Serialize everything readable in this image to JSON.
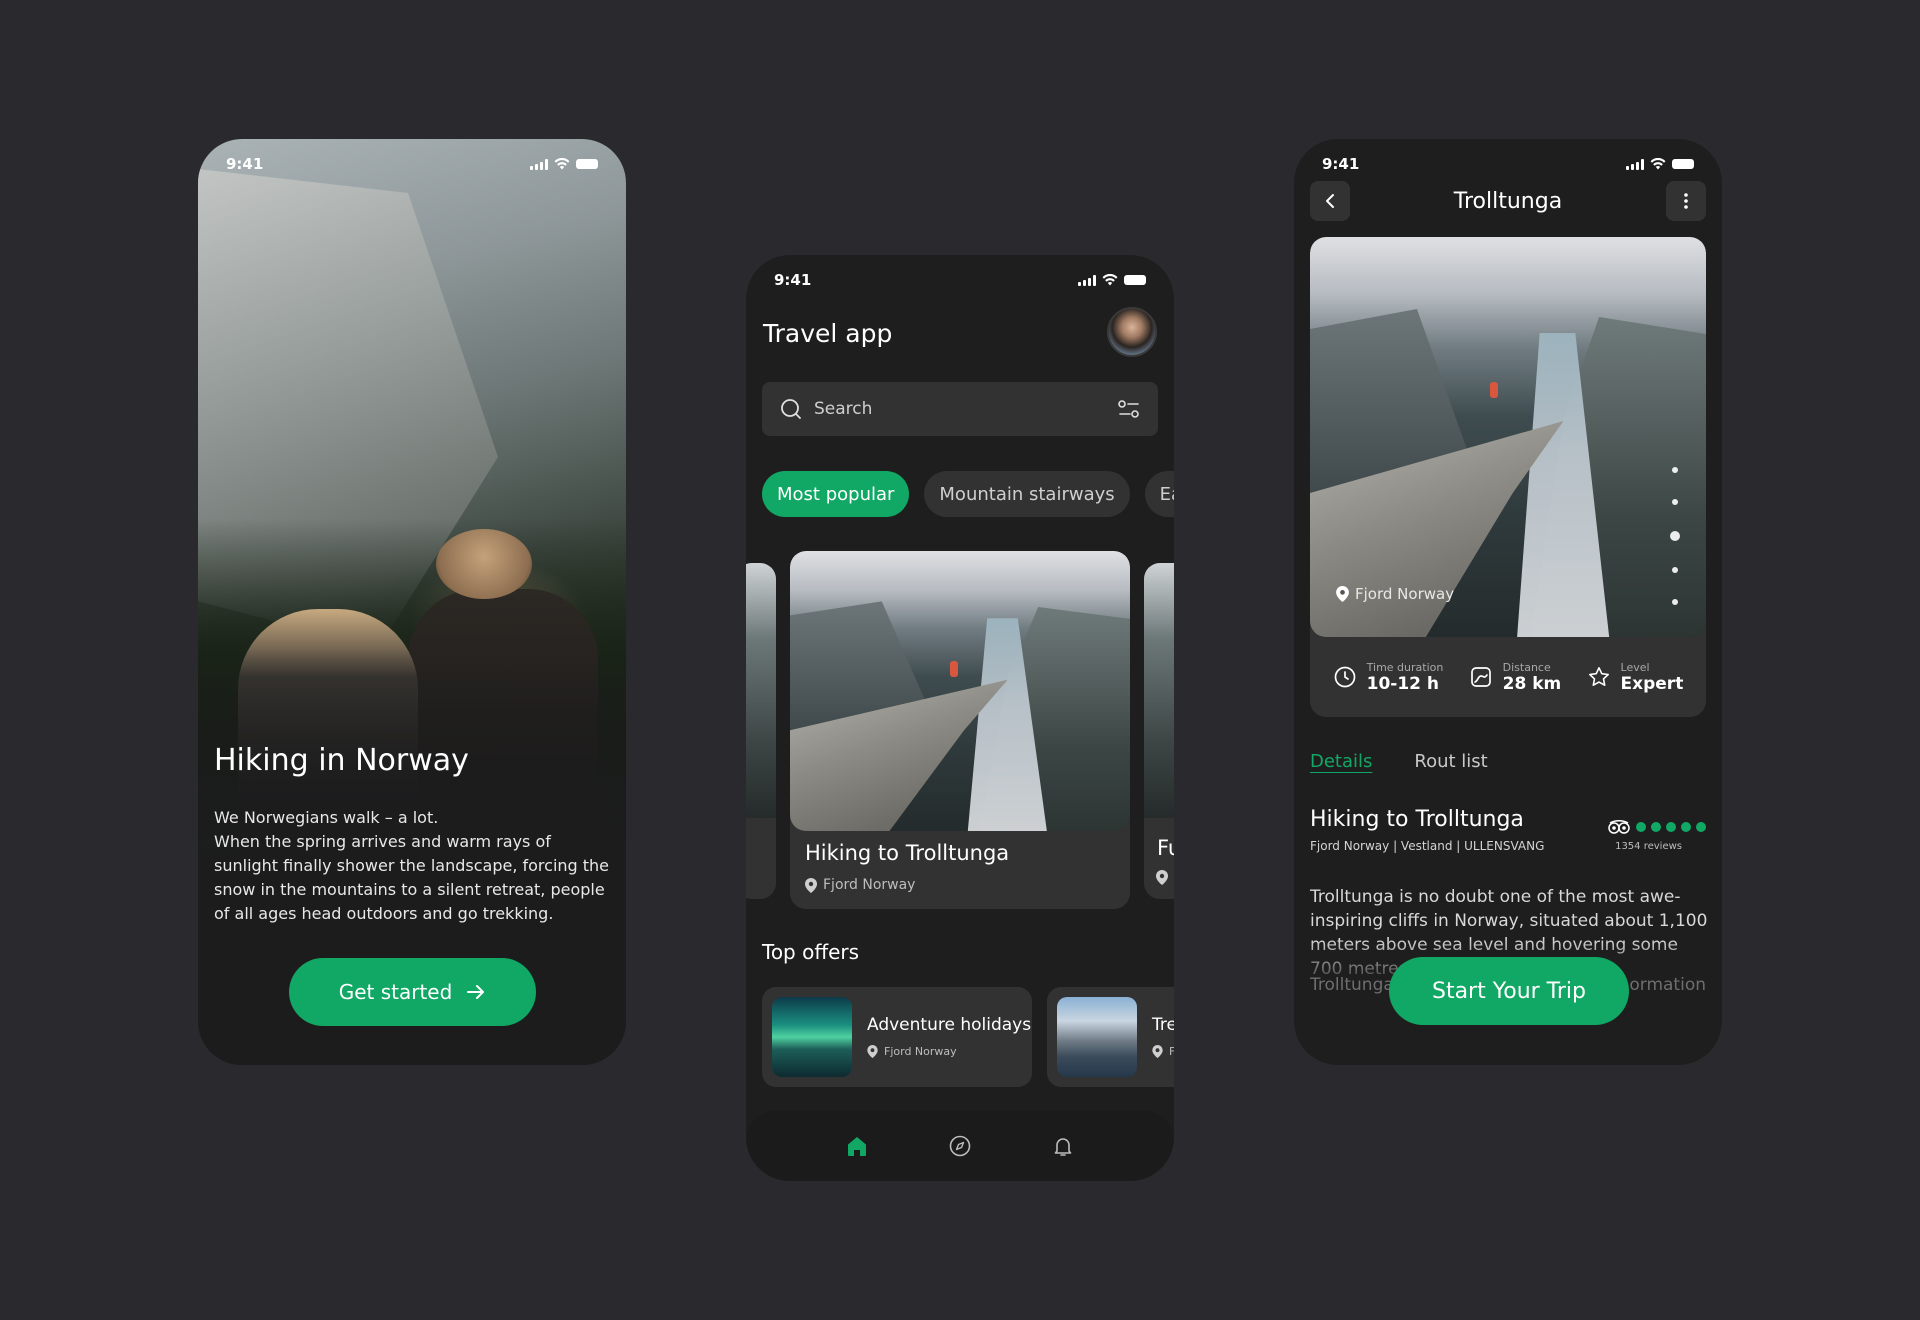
{
  "status": {
    "time": "9:41"
  },
  "colors": {
    "accent": "#11a865",
    "background": "#2a2a2e",
    "phone_bg": "#1f1e1e",
    "surface": "#323232"
  },
  "onboarding": {
    "title": "Hiking in Norway",
    "text_lines": [
      "We Norwegians walk – a lot.",
      "When the spring arrives and warm rays of sunlight finally shower the landscape, forcing the snow in the mountains to a silent retreat, people of all ages head outdoors and go trekking."
    ],
    "cta": "Get started",
    "cta_icon": "arrow-right-icon"
  },
  "home": {
    "app_title": "Travel app",
    "search": {
      "placeholder": "Search",
      "icon": "search-icon",
      "filter_icon": "filter-icon"
    },
    "chips": [
      "Most popular",
      "Mountain stairways",
      "Ea"
    ],
    "featured": {
      "title": "Hiking to Trolltunga",
      "location": "Fjord Norway"
    },
    "side_card": {
      "title": "Fu"
    },
    "top_offers_title": "Top offers",
    "offers": [
      {
        "name": "Adventure holidays",
        "location": "Fjord Norway"
      },
      {
        "name": "Tre",
        "location": "F"
      }
    ],
    "nav": [
      "home-icon",
      "compass-icon",
      "bell-icon"
    ]
  },
  "detail": {
    "page_title": "Trolltunga",
    "location": "Fjord Norway",
    "stats": [
      {
        "label": "Time duration",
        "value": "10-12 h",
        "icon": "clock-icon"
      },
      {
        "label": "Distance",
        "value": "28 km",
        "icon": "route-icon"
      },
      {
        "label": "Level",
        "value": "Expert",
        "icon": "star-icon"
      }
    ],
    "tabs": [
      "Details",
      "Rout list"
    ],
    "title": "Hiking to Trolltunga",
    "subtitle": "Fjord Norway | Vestland | ULLENSVANG",
    "rating_dots": 5,
    "reviews": "1354 reviews",
    "description": "Trolltunga is no doubt one of the most awe-inspiring cliffs in Norway, situated about 1,100 meters above sea level and hovering some 700 metres above the lake",
    "desc_tail_left": "Trolltunga",
    "desc_tail_right": "ormation",
    "cta": "Start Your Trip",
    "carousel_dots": 5,
    "carousel_active": 3
  }
}
